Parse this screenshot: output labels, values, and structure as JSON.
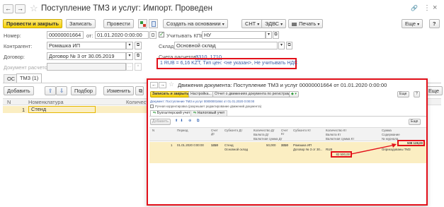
{
  "main": {
    "back_icon": "←",
    "forward_icon": "→",
    "star_icon": "☆",
    "title": "Поступление ТМЗ и услуг: Импорт. Проведен",
    "link_icon": "🔗",
    "more_icon": "⋮",
    "close_icon": "×",
    "toolbar": {
      "post_close": "Провести и закрыть",
      "write": "Записать",
      "post": "Провести",
      "create_based": "Создать на основании",
      "snt": "СНТ",
      "edvs": "ЭДВС",
      "print": "Печать",
      "more": "Еще",
      "help": "?"
    },
    "fields": {
      "number_label": "Номер:",
      "number_value": "00000001664",
      "from_label": "от:",
      "date_value": "01.01.2020 0:00:00",
      "kpn_label": "Учитывать КПН",
      "kpn_value": "НУ",
      "counterparty_label": "Контрагент:",
      "counterparty_value": "Ромашка ИП",
      "warehouse_label": "Склад:",
      "warehouse_value": "Основной склад",
      "contract_label": "Договор:",
      "contract_value": "Договор № 3 от 30.05.2019",
      "accounts_label": "Счета расчетов:",
      "accounts_value": "3310, 1710",
      "payment_doc_label": "Документ расчетов:",
      "rate_line": "1 RUB = 6,16 KZT, Тип цен: <не указан>, Не учитывать НДС"
    },
    "tabs": [
      "ОС",
      "ТМЗ (1)"
    ],
    "table_toolbar": {
      "add": "Добавить",
      "up": "⇧",
      "down": "⇩",
      "select": "Подбор",
      "change": "Изменить",
      "more": "Еще"
    },
    "table_headers": [
      "N",
      "Номенклатура",
      "Количеств"
    ],
    "rows": [
      {
        "n": "1",
        "item": "Стенд"
      }
    ]
  },
  "popup": {
    "title": "Движения документа: Поступление ТМЗ и услуг 00000001664 от 01.01.2020 0:00:00",
    "toolbar": {
      "write_close": "Записать и закрыть",
      "settings": "Настройка...",
      "report": "Отчет о движениях документа по регистрам",
      "more": "Еще",
      "help": "?"
    },
    "doc_line": "Документ: Поступление ТМЗ и услуг 00000001664 от 01.01.2020 0:00:00",
    "manual_label": "Ручная корректировка (разрешает редактирование движений документа)",
    "tabs": [
      "Бухгалтерский учет",
      "Налоговый учет"
    ],
    "grid_toolbar": {
      "add": "Добавить",
      "more": "Еще"
    },
    "headers": {
      "n": "N",
      "period": "Период",
      "dt": "Счет Дт",
      "subconto_dt": "Субконто Дт",
      "qty_dt": "Количество Дт",
      "currency_dt": "Валюта Дт",
      "cur_amount_dt": "Валютная сумма Дт",
      "kt": "Счет Кт",
      "subconto_kt": "Субконто Кт",
      "qty_kt": "Количество Кт",
      "currency_kt": "Валюта Кт",
      "cur_amount_kt": "Валютная сумма Кт",
      "sum": "Сумма",
      "content": "Содержание",
      "journal": "№ журнала"
    },
    "row": {
      "n": "1",
      "period": "01.01.2020 0:00:00",
      "dt": "1310",
      "subconto_dt_1": "Стенд",
      "subconto_dt_2": "Основной склад",
      "qty_dt": "50,000",
      "kt": "3310",
      "subconto_kt_1": "Ромашка ИП",
      "subconto_kt_2": "Договор № 3 от 30...",
      "currency_kt": "RUB",
      "cur_amount_kt": "82 500,00",
      "sum": "508 128,00",
      "content": "Оприходованы ТМЗ"
    }
  }
}
